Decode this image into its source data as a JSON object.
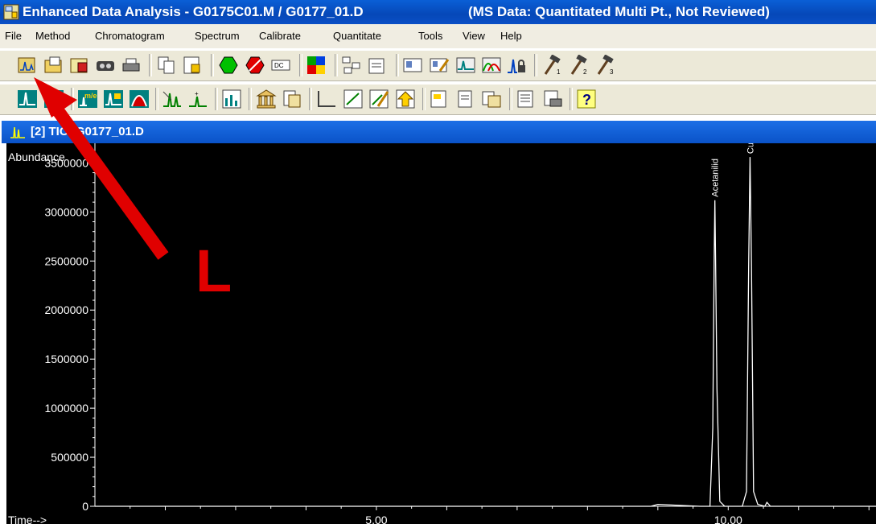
{
  "window": {
    "title": "Enhanced Data Analysis - G0175C01.M / G0177_01.D",
    "subtitle": "(MS Data: Quantitated Multi Pt., Not Reviewed)"
  },
  "menu": [
    "File",
    "Method",
    "Chromatogram",
    "Spectrum",
    "Calibrate",
    "Quantitate",
    "Tools",
    "View",
    "Help"
  ],
  "toolbar1": {
    "icons": [
      "load-data-icon",
      "open-method-icon",
      "save-method-icon",
      "tape-icon",
      "print-icon",
      "copy-icon",
      "export-icon",
      "green-run-icon",
      "red-stop-icon",
      "calculator-icon",
      "color-palette-icon",
      "tree-view-icon",
      "document-icon",
      "report-card-icon",
      "edit-report-icon",
      "tic-icon",
      "overlay-icon",
      "peak-lock-icon",
      "hammer-1-icon",
      "hammer-2-icon",
      "hammer-3-icon"
    ]
  },
  "toolbar2": {
    "icons": [
      "chromatogram-icon",
      "integrate-icon",
      "mz-icon",
      "extract-ion-icon",
      "spectrum-peak-icon",
      "baseline-icon",
      "peak-small-icon",
      "ratio-icon",
      "library-icon",
      "library-search-icon",
      "blank-window-icon",
      "calibrate-icon",
      "edit-curve-icon",
      "quant-icon",
      "qedit-icon",
      "report-icon",
      "copy-report-icon",
      "summary-icon",
      "print-report-icon",
      "help-icon"
    ]
  },
  "child_window": {
    "title": "[2] TIC: G0177_01.D"
  },
  "annotation": {
    "label": "L",
    "color": "#e00000"
  },
  "chart_data": {
    "type": "line",
    "ylabel": "Abundance",
    "xlabel": "Time-->",
    "y_ticks": [
      "3500000",
      "3000000",
      "2500000",
      "2000000",
      "1500000",
      "1000000",
      "500000",
      "0"
    ],
    "x_ticks": [
      "5.00",
      "10.00"
    ],
    "xlim": [
      1.0,
      12.1
    ],
    "ylim": [
      0,
      3700000
    ],
    "peaks": [
      {
        "name": "Acetanilid",
        "x": 9.81,
        "y": 3120000
      },
      {
        "name": "Cumari",
        "x": 10.31,
        "y": 3560000
      }
    ],
    "series": [
      {
        "x": [
          1.0,
          8.9,
          9.0,
          9.6,
          9.74,
          9.78,
          9.8,
          9.81,
          9.82,
          9.84,
          9.88,
          9.95,
          10.2,
          10.26,
          10.29,
          10.31,
          10.33,
          10.36,
          10.42,
          10.52,
          10.55,
          10.6,
          12.1
        ],
        "y": [
          0,
          0,
          20000,
          0,
          0,
          800000,
          2500000,
          3120000,
          2500000,
          1200000,
          50000,
          0,
          0,
          150000,
          2450000,
          3560000,
          2450000,
          150000,
          20000,
          0,
          40000,
          0,
          0
        ]
      }
    ]
  }
}
